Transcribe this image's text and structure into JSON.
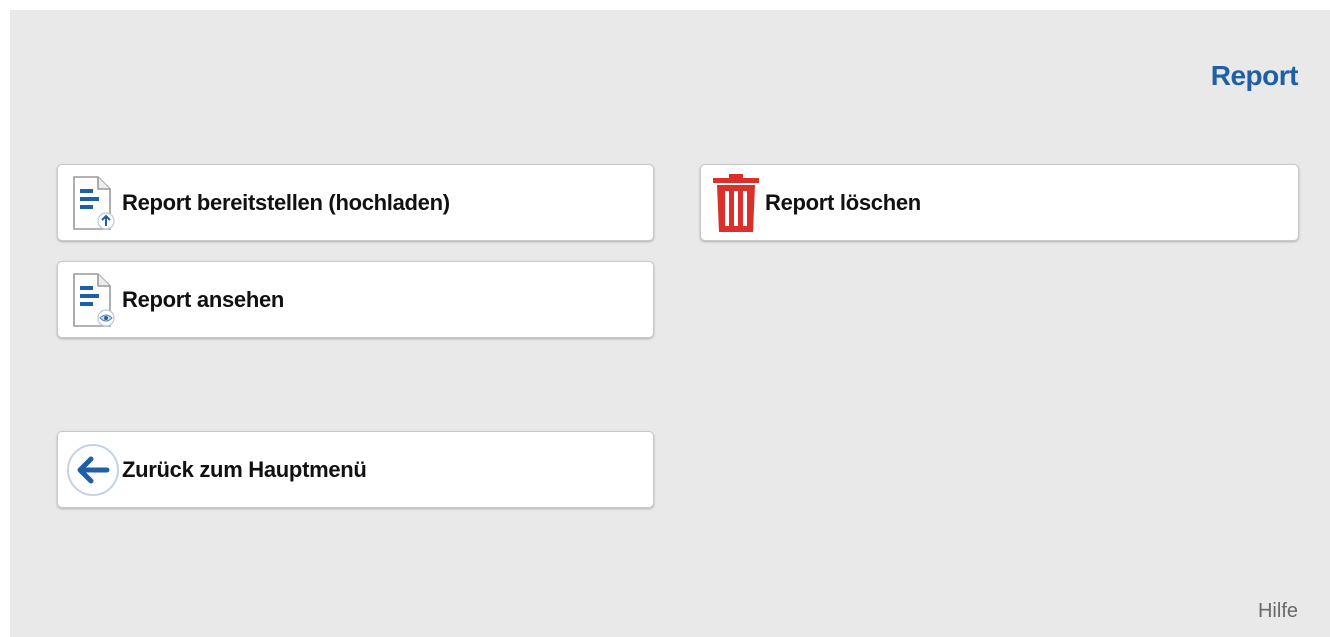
{
  "header": {
    "title": "Report"
  },
  "buttons": {
    "upload": {
      "label": "Report bereitstellen (hochladen)",
      "icon": "document-upload-icon"
    },
    "view": {
      "label": "Report ansehen",
      "icon": "document-view-icon"
    },
    "delete": {
      "label": "Report löschen",
      "icon": "trash-icon"
    },
    "back": {
      "label": "Zurück zum Hauptmenü",
      "icon": "arrow-left-icon"
    }
  },
  "footer": {
    "help_label": "Hilfe"
  },
  "colors": {
    "accent": "#1f5fa6",
    "danger": "#d9302b",
    "background": "#e9e9e9"
  }
}
